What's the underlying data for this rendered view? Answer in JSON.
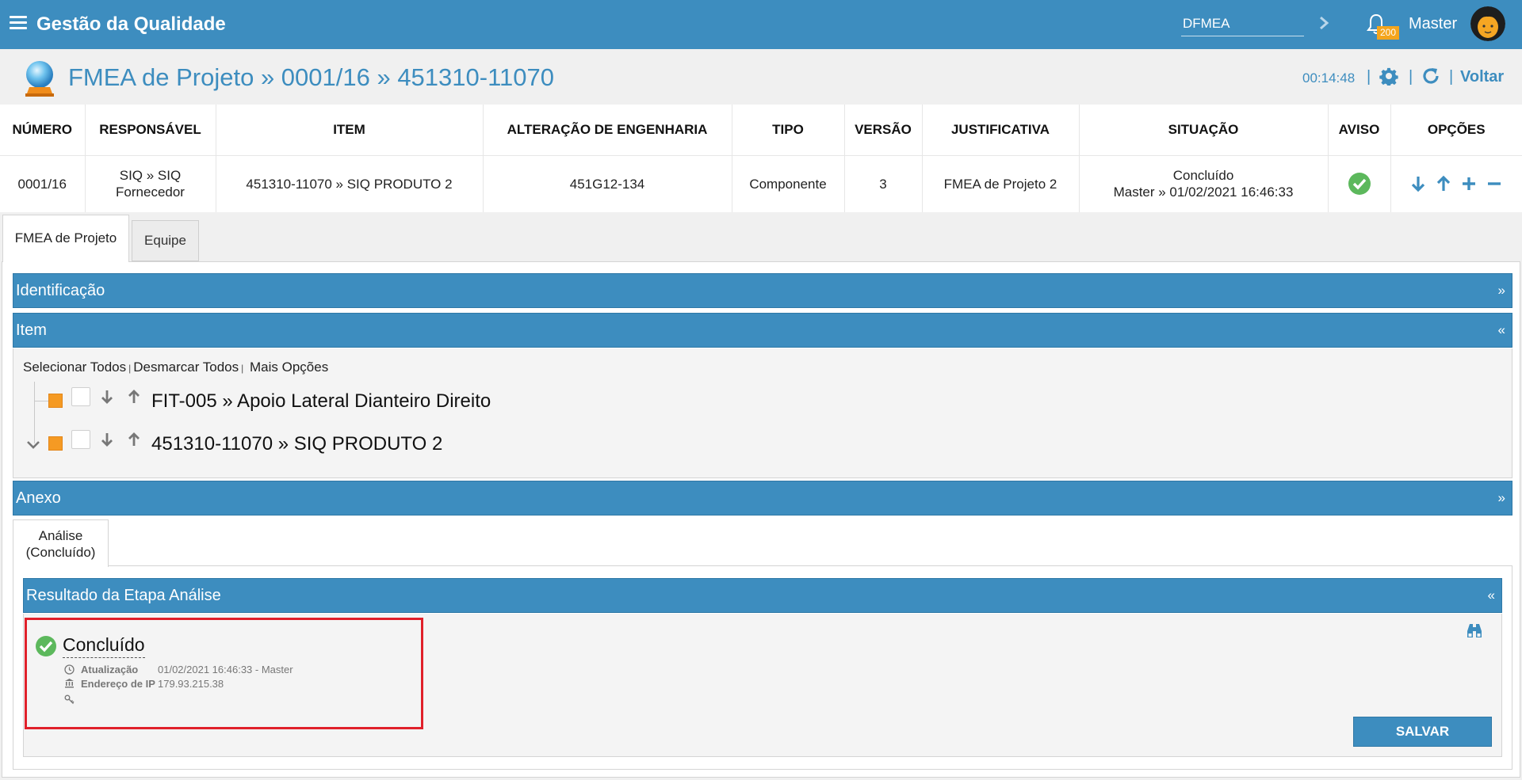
{
  "topbar": {
    "app_title": "Gestão da Qualidade",
    "search_value": "DFMEA",
    "notification_count": "200",
    "user_name": "Master"
  },
  "header": {
    "title": "FMEA de Projeto » 0001/16 » 451310-11070",
    "timer": "00:14:48",
    "back_label": "Voltar"
  },
  "table": {
    "columns": [
      "NÚMERO",
      "RESPONSÁVEL",
      "ITEM",
      "ALTERAÇÃO DE ENGENHARIA",
      "TIPO",
      "VERSÃO",
      "JUSTIFICATIVA",
      "SITUAÇÃO",
      "AVISO",
      "OPÇÕES"
    ],
    "row": {
      "numero": "0001/16",
      "responsavel_1": "SIQ » SIQ",
      "responsavel_2": "Fornecedor",
      "item": "451310-11070 » SIQ PRODUTO 2",
      "alteracao": "451G12-134",
      "tipo": "Componente",
      "versao": "3",
      "justificativa": "FMEA de Projeto 2",
      "situacao_1": "Concluído",
      "situacao_2": "Master » 01/02/2021 16:46:33"
    }
  },
  "tabs": [
    {
      "label": "FMEA de Projeto"
    },
    {
      "label": "Equipe"
    }
  ],
  "sections": {
    "identificacao": "Identificação",
    "item": "Item",
    "anexo": "Anexo",
    "expand_symbol": "»",
    "collapse_symbol": "«"
  },
  "item_actions": {
    "select_all": "Selecionar Todos",
    "deselect_all": "Desmarcar Todos",
    "more_options": "Mais Opções",
    "separator": "|"
  },
  "tree": [
    {
      "label": "FIT-005 » Apoio Lateral Dianteiro Direito"
    },
    {
      "label": "451310-11070 » SIQ PRODUTO 2"
    }
  ],
  "subtab": {
    "line1": "Análise",
    "line2": "(Concluído)"
  },
  "result": {
    "title": "Resultado da Etapa Análise",
    "status": "Concluído",
    "update_label": "Atualização",
    "update_value": "01/02/2021 16:46:33 - Master",
    "ip_label": "Endereço de IP",
    "ip_value": "179.93.215.38",
    "save_label": "SALVAR"
  },
  "colors": {
    "primary": "#3d8dbf",
    "success": "#5cb85c",
    "highlight": "#e0202a",
    "node": "#f59a23"
  }
}
